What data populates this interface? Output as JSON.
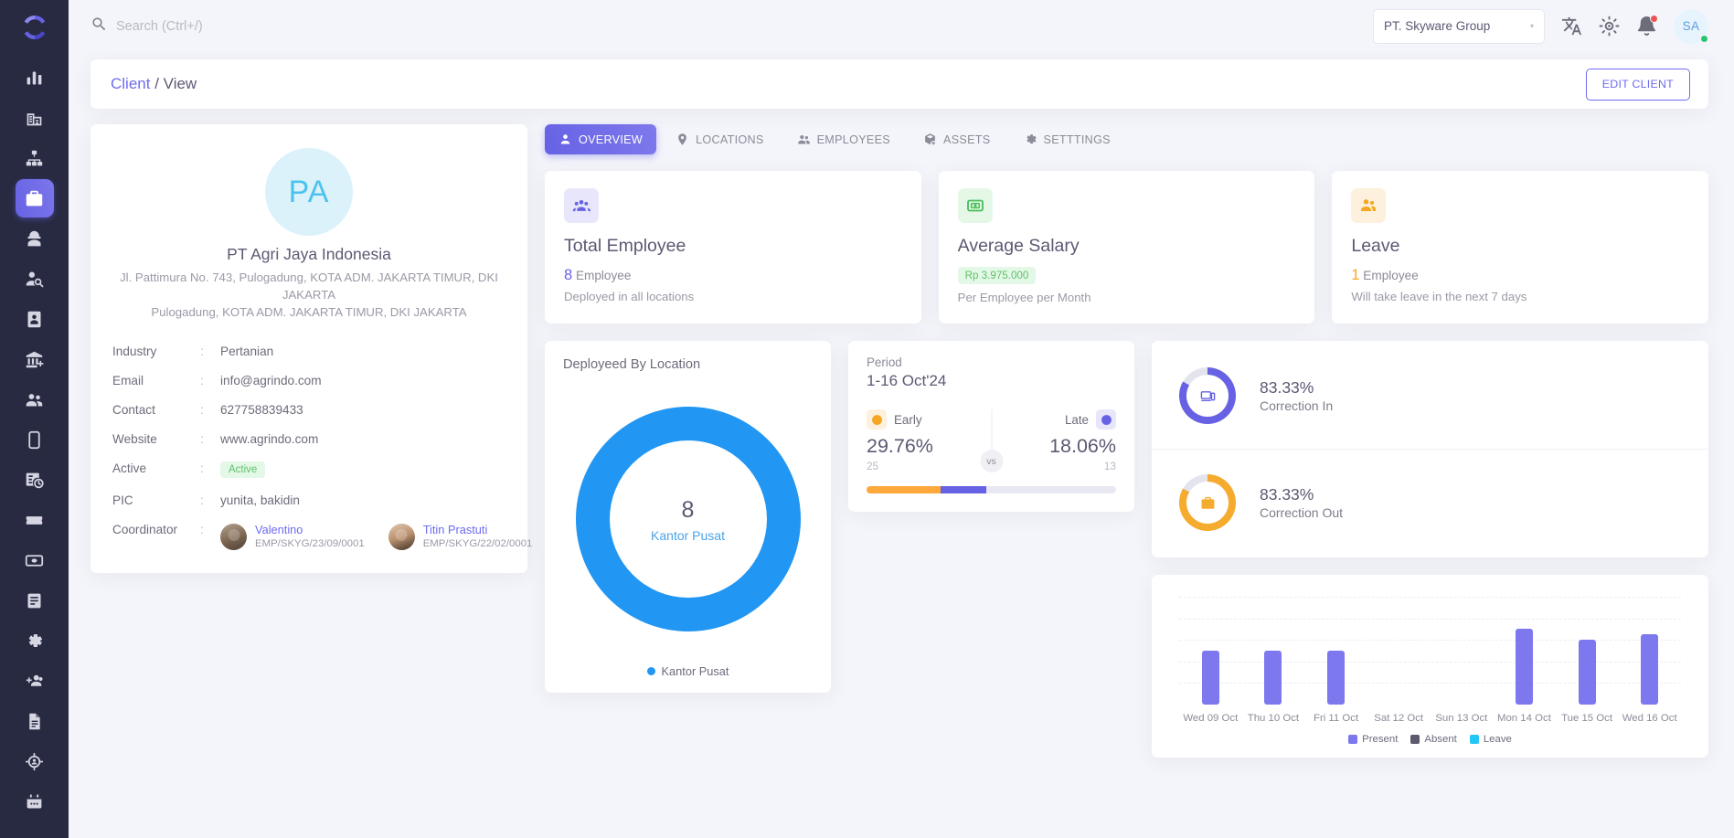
{
  "sidebar": {
    "logo_name": "app-logo",
    "items": [
      {
        "id": "dashboard",
        "icon": "bar-chart-icon",
        "label": "Dashboard",
        "active": false
      },
      {
        "id": "company",
        "icon": "building-icon",
        "label": "Company",
        "active": false
      },
      {
        "id": "structure",
        "icon": "org-chart-icon",
        "label": "Organization",
        "active": false
      },
      {
        "id": "client",
        "icon": "briefcase-user-icon",
        "label": "Client",
        "active": true
      },
      {
        "id": "worker",
        "icon": "helmet-worker-icon",
        "label": "Worker",
        "active": false
      },
      {
        "id": "recruit",
        "icon": "user-search-icon",
        "label": "Recruitment",
        "active": false
      },
      {
        "id": "idcard",
        "icon": "id-card-icon",
        "label": "ID Card",
        "active": false
      },
      {
        "id": "bank",
        "icon": "bank-add-icon",
        "label": "Bank",
        "active": false
      },
      {
        "id": "people",
        "icon": "users-icon",
        "label": "People",
        "active": false
      },
      {
        "id": "mobile",
        "icon": "mobile-icon",
        "label": "Mobile",
        "active": false
      },
      {
        "id": "attendance",
        "icon": "schedule-clock-icon",
        "label": "Attendance",
        "active": false
      },
      {
        "id": "ticket",
        "icon": "ticket-icon",
        "label": "Ticket",
        "active": false
      },
      {
        "id": "payroll",
        "icon": "money-icon",
        "label": "Payroll",
        "active": false
      },
      {
        "id": "report",
        "icon": "document-lines-icon",
        "label": "Report",
        "active": false
      },
      {
        "id": "settings",
        "icon": "gear-icon",
        "label": "Settings",
        "active": false
      },
      {
        "id": "adduser",
        "icon": "user-plus-icon",
        "label": "Add User",
        "active": false
      },
      {
        "id": "files",
        "icon": "file-icon",
        "label": "Files",
        "active": false
      },
      {
        "id": "tracking",
        "icon": "target-user-icon",
        "label": "Tracking",
        "active": false
      },
      {
        "id": "calendar",
        "icon": "calendar-icon",
        "label": "Calendar",
        "active": false
      }
    ]
  },
  "topbar": {
    "search_placeholder": "Search (Ctrl+/)",
    "search_value": "",
    "search_icon": "search-icon",
    "org_selected": "PT. Skyware Group",
    "org_caret": "▾",
    "translate_icon": "translate-icon",
    "theme_icon": "sun-theme-icon",
    "notification_icon": "bell-icon",
    "avatar_initials": "SA",
    "status_color": "#28c76f"
  },
  "breadcrumb": {
    "root": "Client",
    "separator": "/",
    "current": "View",
    "edit_button": "EDIT CLIENT"
  },
  "profile": {
    "avatar_initials": "PA",
    "avatar_bg": "#dbf2fb",
    "avatar_fg": "#4cc3ec",
    "name": "PT Agri Jaya Indonesia",
    "address_line1": "Jl. Pattimura No. 743, Pulogadung, KOTA ADM. JAKARTA TIMUR, DKI JAKARTA",
    "address_line2": "Pulogadung, KOTA ADM. JAKARTA TIMUR, DKI JAKARTA",
    "fields": [
      {
        "key": "Industry",
        "value": "Pertanian"
      },
      {
        "key": "Email",
        "value": "info@agrindo.com"
      },
      {
        "key": "Contact",
        "value": "627758839433"
      },
      {
        "key": "Website",
        "value": "www.agrindo.com"
      },
      {
        "key": "Active",
        "value": "Active",
        "type": "badge"
      },
      {
        "key": "PIC",
        "value": "yunita, bakidin"
      }
    ],
    "coordinator_key": "Coordinator",
    "coordinators": [
      {
        "name": "Valentino",
        "code": "EMP/SKYG/23/09/0001"
      },
      {
        "name": "Titin Prastuti",
        "code": "EMP/SKYG/22/02/0001"
      }
    ]
  },
  "tabs": [
    {
      "label": "OVERVIEW",
      "icon": "user-badge-icon",
      "active": true
    },
    {
      "label": "LOCATIONS",
      "icon": "map-pin-icon",
      "active": false
    },
    {
      "label": "EMPLOYEES",
      "icon": "users-icon",
      "active": false
    },
    {
      "label": "ASSETS",
      "icon": "box-add-icon",
      "active": false
    },
    {
      "label": "SETTTINGS",
      "icon": "gear-icon",
      "active": false
    }
  ],
  "stats": [
    {
      "icon": "users-group-icon",
      "icon_bg": "#e7e6fb",
      "icon_fg": "#6762e4",
      "title": "Total Employee",
      "number": "8",
      "number_color": "#6762e4",
      "unit": "Employee",
      "subtitle": "Deployed in all locations",
      "pill": null
    },
    {
      "icon": "money-bill-icon",
      "icon_bg": "#e5f8e8",
      "icon_fg": "#49bf5a",
      "title": "Average Salary",
      "number": null,
      "number_color": null,
      "unit": null,
      "subtitle": "Per Employee per Month",
      "pill": "Rp 3.975.000"
    },
    {
      "icon": "people-leave-icon",
      "icon_bg": "#fdf0dc",
      "icon_fg": "#f5a623",
      "title": "Leave",
      "number": "1",
      "number_color": "#f5a623",
      "unit": "Employee",
      "subtitle": "Will take leave in the next 7 days",
      "pill": null
    }
  ],
  "period": {
    "label": "Period",
    "value": "1-16 Oct'24",
    "vs_text": "vs",
    "early": {
      "label": "Early",
      "icon": "clock-early-icon",
      "pct": "29.76%",
      "count": "25",
      "color": "#ffa93c",
      "bg": "#fdf0dc"
    },
    "late": {
      "label": "Late",
      "icon": "clock-late-icon",
      "pct": "18.06%",
      "count": "13",
      "color": "#6762e4",
      "bg": "#e7e6fb"
    }
  },
  "correction": [
    {
      "pct": "83.33%",
      "label": "Correction In",
      "icon": "device-in-icon",
      "color": "#6762e4",
      "value": 83.33
    },
    {
      "pct": "83.33%",
      "label": "Correction Out",
      "icon": "briefcase-icon",
      "color": "#f5ab2e",
      "value": 83.33
    }
  ],
  "chart_data": [
    {
      "type": "pie",
      "title": "Deployeed By Location",
      "labels": [
        "Kantor Pusat"
      ],
      "values": [
        8
      ],
      "colors": [
        "#2196f3"
      ],
      "center_value": "8",
      "center_label": "Kantor Pusat",
      "legend": [
        "Kantor Pusat"
      ],
      "legend_position": "bottom",
      "donut": true
    },
    {
      "type": "bar",
      "title": "",
      "categories": [
        "Wed 09 Oct",
        "Thu 10 Oct",
        "Fri 11 Oct",
        "Sat 12 Oct",
        "Sun 13 Oct",
        "Mon 14 Oct",
        "Tue 15 Oct",
        "Wed 16 Oct"
      ],
      "series": [
        {
          "name": "Present",
          "color": "#7d78ee",
          "values": [
            5,
            5,
            5,
            0,
            0,
            7,
            6,
            6.5
          ]
        },
        {
          "name": "Absent",
          "color": "#5d5a6e",
          "values": [
            0,
            0,
            0,
            0,
            0,
            0,
            0,
            0
          ]
        },
        {
          "name": "Leave",
          "color": "#23c6f5",
          "values": [
            0,
            0,
            0,
            0,
            0,
            0,
            0,
            0
          ]
        }
      ],
      "ylim": [
        0,
        10
      ],
      "grid": true,
      "gridlines": 5,
      "legend": [
        "Present",
        "Absent",
        "Leave"
      ],
      "legend_position": "bottom",
      "xlabel": "",
      "ylabel": ""
    }
  ]
}
